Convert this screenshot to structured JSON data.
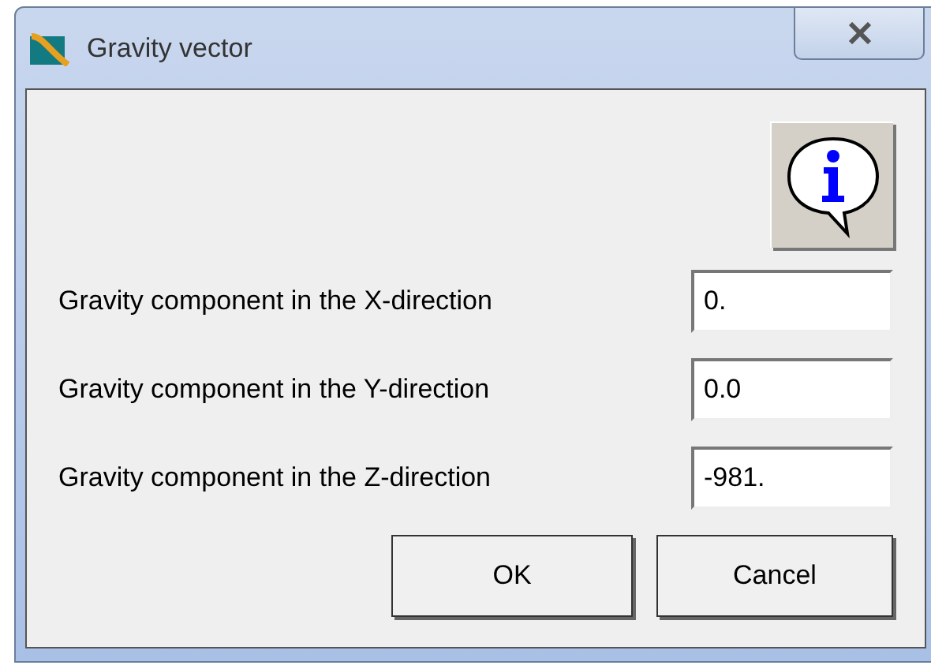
{
  "window": {
    "title": "Gravity vector"
  },
  "fields": [
    {
      "label": "Gravity component in the X-direction",
      "value": "0."
    },
    {
      "label": "Gravity component in the Y-direction",
      "value": "0.0"
    },
    {
      "label": "Gravity component in the Z-direction",
      "value": "-981."
    }
  ],
  "buttons": [
    "OK",
    "Cancel"
  ]
}
